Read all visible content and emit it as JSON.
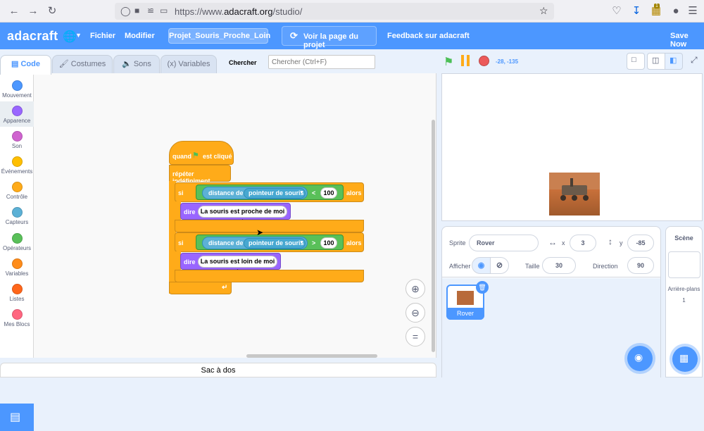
{
  "browser": {
    "url": "https://www.adacraft.org/studio/",
    "url_prefix": "https://www.",
    "url_domain": "adacraft.org",
    "url_path": "/studio/",
    "download_badge": "1"
  },
  "menu": {
    "logo": "adacraft",
    "file": "Fichier",
    "edit": "Modifier",
    "project_name": "Projet_Souris_Proche_Loin",
    "see_project": "Voir la page du projet",
    "feedback": "Feedback sur adacraft",
    "save": "Save Now"
  },
  "tabs": {
    "code": "Code",
    "costumes": "Costumes",
    "sounds": "Sons",
    "variables": "Variables",
    "search_label": "Chercher",
    "search_placeholder": "Chercher (Ctrl+F)"
  },
  "categories": [
    {
      "label": "Mouvement",
      "color": "#4c97ff"
    },
    {
      "label": "Apparence",
      "color": "#9966ff"
    },
    {
      "label": "Son",
      "color": "#cf63cf"
    },
    {
      "label": "Événements",
      "color": "#ffbf00"
    },
    {
      "label": "Contrôle",
      "color": "#ffab19"
    },
    {
      "label": "Capteurs",
      "color": "#5cb1d6"
    },
    {
      "label": "Opérateurs",
      "color": "#59c059"
    },
    {
      "label": "Variables",
      "color": "#ff8c1a"
    },
    {
      "label": "Listes",
      "color": "#ff661a"
    },
    {
      "label": "Mes Blocs",
      "color": "#ff6680"
    }
  ],
  "script": {
    "when_prefix": "quand",
    "when_suffix": "est cliqué",
    "forever": "répéter indéfiniment",
    "if1": {
      "if": "si",
      "sensor": "distance de",
      "target": "pointeur de souris",
      "op": "<",
      "value": "100",
      "then": "alors",
      "say_label": "dire",
      "say_text": "La souris est proche de moi !"
    },
    "if2": {
      "if": "si",
      "sensor": "distance de",
      "target": "pointeur de souris",
      "op": ">",
      "value": "100",
      "then": "alors",
      "say_label": "dire",
      "say_text": "La souris est loin de moi !"
    }
  },
  "backpack": "Sac à dos",
  "stage": {
    "coords": "-28, -135"
  },
  "sprite": {
    "label": "Sprite",
    "name": "Rover",
    "x_label": "x",
    "x": "3",
    "y_label": "y",
    "y": "-85",
    "show_label": "Afficher",
    "size_label": "Taille",
    "size": "30",
    "direction_label": "Direction",
    "direction": "90",
    "thumb_name": "Rover"
  },
  "scene": {
    "title": "Scène",
    "backdrops_label": "Arrière-plans",
    "backdrops_count": "1"
  },
  "colors": {
    "accent": "#4c97ff",
    "control": "#ffab19",
    "looks": "#9966ff",
    "operators": "#59c059",
    "sensing": "#5cb1d6"
  }
}
